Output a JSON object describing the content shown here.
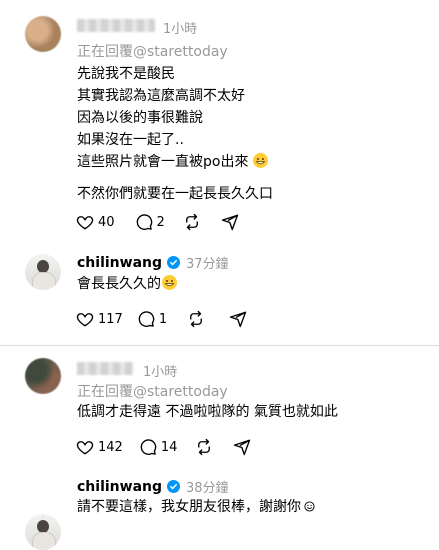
{
  "comments": [
    {
      "time": "1小時",
      "reply_prefix": "正在回覆",
      "reply_to": "@starettoday",
      "lines": [
        "先說我不是酸民",
        "其實我認為這麼高調不太好",
        "因為以後的事很難說",
        "如果沒在一起了..",
        "這些照片就會一直被po出來"
      ],
      "extra_line": "不然你們就要在一起長長久久口",
      "likes": "40",
      "replies": "2"
    },
    {
      "username": "chilinwang",
      "time": "37分鐘",
      "text": "會長長久久的",
      "likes": "117",
      "replies": "1"
    },
    {
      "time": "1小時",
      "reply_prefix": "正在回覆",
      "reply_to": "@starettoday",
      "text": "低調才走得遠 不過啦啦隊的 氣質也就如此",
      "likes": "142",
      "replies": "14"
    },
    {
      "username": "chilinwang",
      "time": "38分鐘",
      "text": "請不要這樣，我女朋友很棒，謝謝你"
    }
  ],
  "icons": {
    "like": "heart-icon",
    "comment": "comment-bubble-icon",
    "repost": "repost-icon",
    "share": "share-send-icon",
    "verified": "verified-badge-icon"
  },
  "colors": {
    "verified": "#0095f6",
    "secondary_text": "#999999",
    "emoji": "#ffcc33"
  }
}
